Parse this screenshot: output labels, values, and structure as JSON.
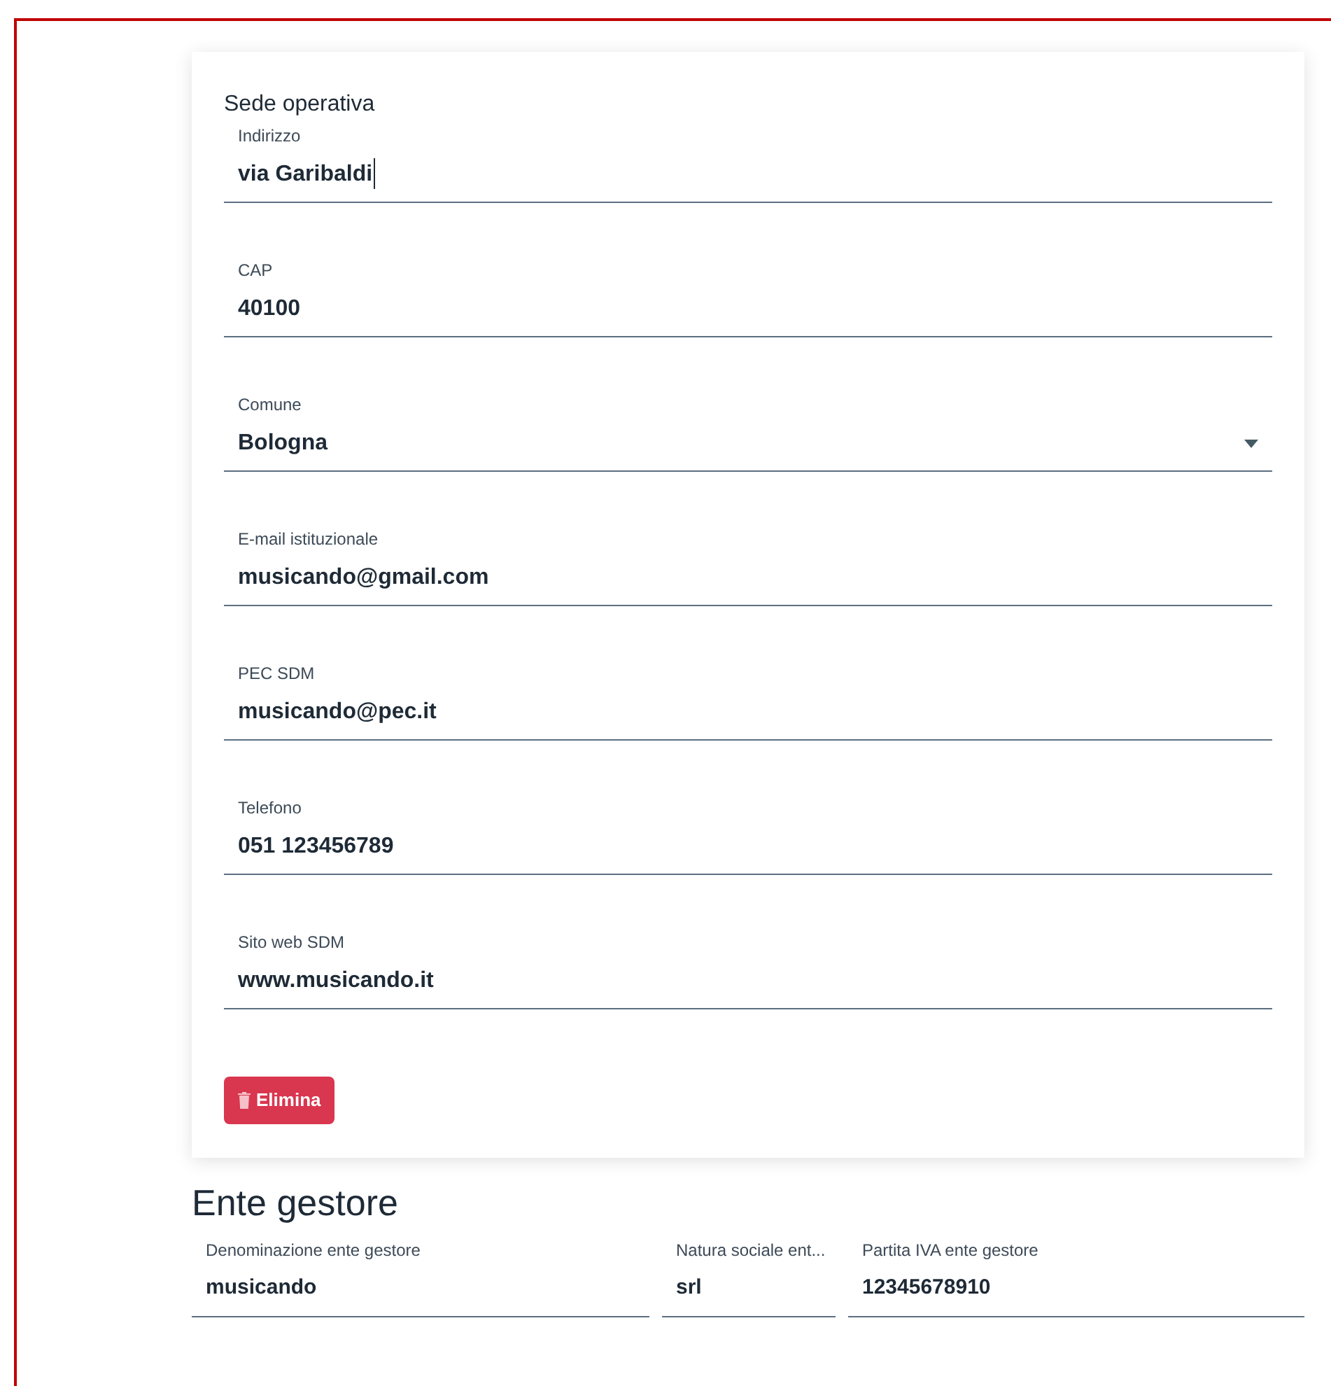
{
  "sede": {
    "title": "Sede operativa",
    "fields": [
      {
        "kind": "text",
        "label": "Indirizzo",
        "value": "via Garibaldi",
        "focused": true
      },
      {
        "kind": "text",
        "label": "CAP",
        "value": "40100",
        "focused": false
      },
      {
        "kind": "select",
        "label": "Comune",
        "value": "Bologna",
        "focused": false
      },
      {
        "kind": "text",
        "label": "E-mail istituzionale",
        "value": "musicando@gmail.com",
        "focused": false
      },
      {
        "kind": "text",
        "label": "PEC SDM",
        "value": "musicando@pec.it",
        "focused": false
      },
      {
        "kind": "text",
        "label": "Telefono",
        "value": "051 123456789",
        "focused": false
      },
      {
        "kind": "text",
        "label": "Sito web SDM",
        "value": "www.musicando.it",
        "focused": false
      }
    ],
    "delete_button": "Elimina"
  },
  "ente": {
    "title": "Ente gestore",
    "fields": [
      {
        "label": "Denominazione ente gestore",
        "value": "musicando"
      },
      {
        "label": "Natura sociale ent...",
        "value": "srl"
      },
      {
        "label": "Partita IVA ente gestore",
        "value": "12345678910"
      }
    ]
  }
}
